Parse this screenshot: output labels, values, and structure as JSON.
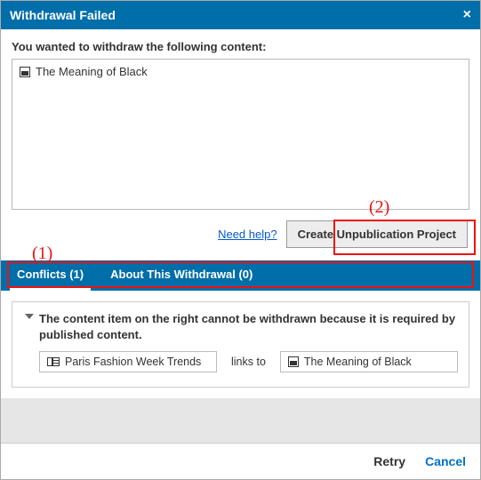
{
  "dialog": {
    "title": "Withdrawal Failed",
    "prompt": "You wanted to withdraw the following content:",
    "content_items": [
      {
        "label": "The Meaning of Black"
      }
    ],
    "help_link": "Need help?",
    "create_button": "Create Unpublication Project",
    "tabs": [
      {
        "label": "Conflicts (1)",
        "active": true
      },
      {
        "label": "About This Withdrawal (0)",
        "active": false
      }
    ],
    "conflict": {
      "message": "The content item on the right cannot be withdrawn because it is required by published content.",
      "source": "Paris Fashion Week Trends",
      "relation": "links to",
      "target": "The Meaning of Black"
    },
    "footer": {
      "retry": "Retry",
      "cancel": "Cancel"
    }
  },
  "annotations": {
    "one": "(1)",
    "two": "(2)"
  }
}
